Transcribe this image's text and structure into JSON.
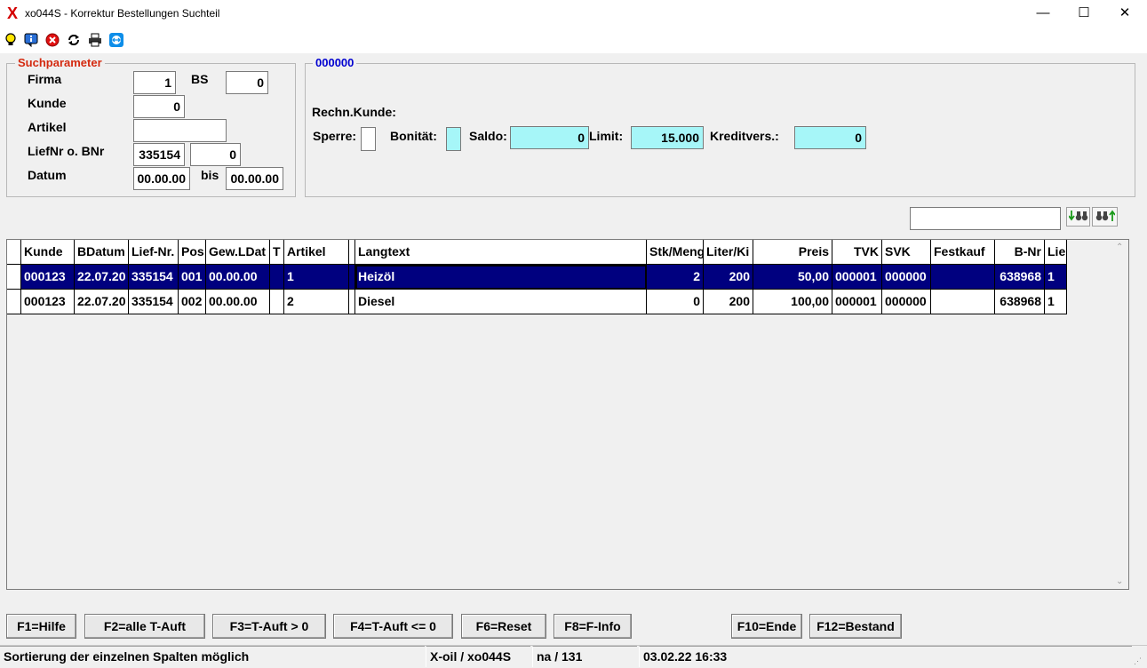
{
  "window": {
    "title": "xo044S - Korrektur Bestellungen Suchteil",
    "logo": "X",
    "minimize": "—",
    "maximize": "☐",
    "close": "✕"
  },
  "toolbar": {
    "icons": [
      "lightbulb-icon",
      "info-icon",
      "cancel-icon",
      "refresh-icon",
      "print-icon",
      "teamviewer-icon"
    ]
  },
  "search": {
    "legend": "Suchparameter",
    "firma_label": "Firma",
    "firma_value": "1",
    "bs_label": "BS",
    "bs_value": "0",
    "kunde_label": "Kunde",
    "kunde_value": "0",
    "artikel_label": "Artikel",
    "artikel_value": "",
    "liefnr_label": "LiefNr o. BNr",
    "liefnr_value": "335154",
    "bnr_value": "0",
    "datum_label": "Datum",
    "datum_from": "00.00.00",
    "bis_label": "bis",
    "datum_to": "00.00.00"
  },
  "customer": {
    "legend": "000000",
    "rechn_label": "Rechn.Kunde:",
    "sperre_label": "Sperre:",
    "sperre_value": "",
    "bonitaet_label": "Bonität:",
    "bonitaet_value": "",
    "saldo_label": "Saldo:",
    "saldo_value": "0",
    "limit_label": "Limit:",
    "limit_value": "15.000",
    "kreditvers_label": "Kreditvers.:",
    "kreditvers_value": "0"
  },
  "quicksearch": {
    "value": ""
  },
  "table": {
    "headers": [
      "",
      "Kunde",
      "BDatum",
      "Lief-Nr.",
      "Pos",
      "Gew.LDat",
      "T",
      "Artikel",
      "",
      "Langtext",
      "Stk/Meng",
      "Liter/Ki",
      "Preis",
      "TVK",
      "SVK",
      "Festkauf",
      "B-Nr",
      "Lie"
    ],
    "rows": [
      [
        "",
        "000123",
        "22.07.20",
        "335154",
        "001",
        "00.00.00",
        "",
        "1",
        "",
        "Heizöl",
        "2",
        "200",
        "50,00",
        "000001",
        "000000",
        "",
        "638968",
        "1"
      ],
      [
        "",
        "000123",
        "22.07.20",
        "335154",
        "002",
        "00.00.00",
        "",
        "2",
        "",
        "Diesel",
        "0",
        "200",
        "100,00",
        "000001",
        "000000",
        "",
        "638968",
        "1"
      ]
    ]
  },
  "buttons": {
    "f1": "F1=Hilfe",
    "f2": "F2=alle T-Auft",
    "f3": "F3=T-Auft > 0",
    "f4": "F4=T-Auft <= 0",
    "f6": "F6=Reset",
    "f8": "F8=F-Info",
    "f10": "F10=Ende",
    "f12": "F12=Bestand"
  },
  "status": {
    "message": "Sortierung der einzelnen Spalten möglich",
    "program": "X-oil / xo044S",
    "user": "na / 131",
    "datetime": "03.02.22 16:33"
  },
  "colors": {
    "selection": "#00007f",
    "info_field": "#a6f6f8",
    "legend_red": "#d42a10",
    "legend_blue": "#0000d0"
  }
}
